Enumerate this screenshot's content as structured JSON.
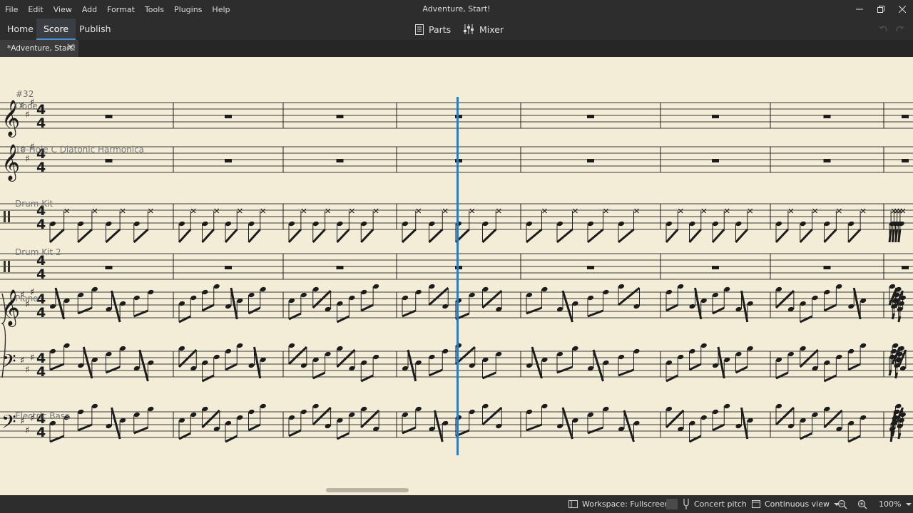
{
  "menu": [
    "File",
    "Edit",
    "View",
    "Add",
    "Format",
    "Tools",
    "Plugins",
    "Help"
  ],
  "window_title": "Adventure, Start!",
  "tabs": {
    "home": "Home",
    "score": "Score",
    "publish": "Publish"
  },
  "toolbar": {
    "parts": "Parts",
    "mixer": "Mixer"
  },
  "document_tab": {
    "title": "*Adventure, Start!"
  },
  "score": {
    "measure_number": "#32",
    "instruments": [
      {
        "name": "Oboe",
        "clef": "treble",
        "key": "A major (3 sharps)",
        "time": "4/4"
      },
      {
        "name": "10-Hole C Diatonic Harmonica",
        "clef": "treble",
        "key": "A major (3 sharps)",
        "time": "4/4"
      },
      {
        "name": "Drum Kit",
        "clef": "percussion",
        "time": "4/4"
      },
      {
        "name": "Drum Kit 2",
        "clef": "percussion",
        "time": "4/4"
      },
      {
        "name": "Piano",
        "clef": "treble + bass",
        "key": "A major (3 sharps)",
        "time": "4/4"
      },
      {
        "name": "Electric Bass",
        "clef": "bass",
        "key": "A major (3 sharps)",
        "time": "4/4"
      }
    ]
  },
  "statusbar": {
    "workspace": "Workspace: Fullscreen",
    "concert_pitch": "Concert pitch",
    "view_mode": "Continuous view",
    "zoom": "100%"
  },
  "colors": {
    "score_bg": "#f3ecd6",
    "playhead": "#2f7bc0",
    "accent": "#4c8fd6"
  }
}
